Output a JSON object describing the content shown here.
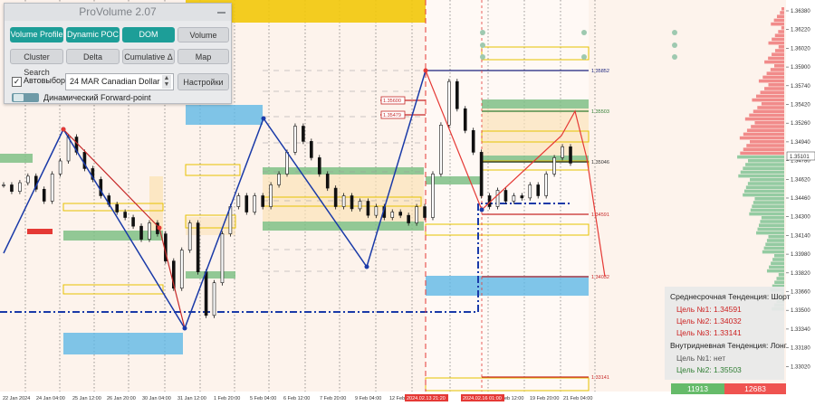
{
  "panel": {
    "title": "ProVolume 2.07",
    "buttons": [
      "Volume Profile",
      "Dynamic POC",
      "DOM",
      "Volume",
      "Cluster Search",
      "Delta",
      "Cumulative Δ",
      "Map"
    ],
    "auto_label": "Автовыбор",
    "instrument": "24 MAR Canadian Dollar",
    "settings_label": "Настройки",
    "forward_label": "Динамический Forward-point"
  },
  "info": {
    "mid_trend": "Среднесрочная Тенденция: Шорт",
    "mid_targets": [
      "Цель №1: 1.34591",
      "Цель №2: 1.34032",
      "Цель №3: 1.33141"
    ],
    "intra_trend": "Внутридневная Тенденция: Лонг",
    "intra_targets": [
      "Цель №1: нет",
      "Цель №2: 1.35503"
    ]
  },
  "volume_bar": {
    "left": "11913",
    "right": "12683"
  },
  "chart_data": {
    "type": "candlestick",
    "instrument": "24 MAR Canadian Dollar",
    "y_ticks": [
      "1.36380",
      "1.36220",
      "1.36020",
      "1.35900",
      "1.35740",
      "1.35420",
      "1.35260",
      "1.34940",
      "1.34780",
      "1.34620",
      "1.34460",
      "1.34300",
      "1.34140",
      "1.33980",
      "1.33820",
      "1.33660",
      "1.33500",
      "1.33340",
      "1.33180",
      "1.33020"
    ],
    "ylim": [
      1.33,
      1.365
    ],
    "current_price": "1.35101",
    "x_ticks": [
      "22 Jan 2024",
      "24 Jan 04:00",
      "25 Jan 12:00",
      "26 Jan 20:00",
      "30 Jan 04:00",
      "31 Jan 12:00",
      "1 Feb 20:00",
      "5 Feb 04:00",
      "6 Feb 12:00",
      "7 Feb 20:00",
      "9 Feb 04:00",
      "12 Feb",
      "2024.02.13 21:20",
      "2024.02.16 01:00",
      "eb 12:00",
      "19 Feb 20:00",
      "21 Feb 04:00"
    ],
    "levels": [
      {
        "label": "1.35852",
        "price": 1.35852,
        "color": "#1a237e"
      },
      {
        "label": "1.35503",
        "price": 1.35503,
        "color": "#2e7d32"
      },
      {
        "label": "1.35046",
        "price": 1.35046,
        "color": "#333333"
      },
      {
        "label": "1.34591",
        "price": 1.34591,
        "color": "#c62828"
      },
      {
        "label": "1.34032",
        "price": 1.34032,
        "color": "#c62828"
      },
      {
        "label": "1.33141",
        "price": 1.33141,
        "color": "#c62828"
      },
      {
        "label": "1.35600",
        "price": 1.356,
        "color": "#c62828"
      },
      {
        "label": "1.35479",
        "price": 1.35479,
        "color": "#c62828"
      }
    ],
    "close_path": [
      1.349,
      1.3484,
      1.3492,
      1.3498,
      1.3486,
      1.3475,
      1.35,
      1.3512,
      1.3534,
      1.352,
      1.3505,
      1.3495,
      1.348,
      1.3472,
      1.3465,
      1.346,
      1.3452,
      1.344,
      1.3455,
      1.3445,
      1.342,
      1.3395,
      1.343,
      1.3455,
      1.341,
      1.337,
      1.34,
      1.3445,
      1.347,
      1.348,
      1.3465,
      1.348,
      1.347,
      1.349,
      1.35,
      1.352,
      1.3544,
      1.353,
      1.3515,
      1.35,
      1.3487,
      1.347,
      1.348,
      1.3468,
      1.3475,
      1.3462,
      1.347,
      1.346,
      1.3465,
      1.3462,
      1.3455,
      1.347,
      1.346,
      1.35,
      1.3545,
      1.3585,
      1.356,
      1.354,
      1.352,
      1.348,
      1.347,
      1.3485,
      1.3475,
      1.348,
      1.3478,
      1.349,
      1.348,
      1.35,
      1.3515,
      1.3525,
      1.351
    ]
  }
}
